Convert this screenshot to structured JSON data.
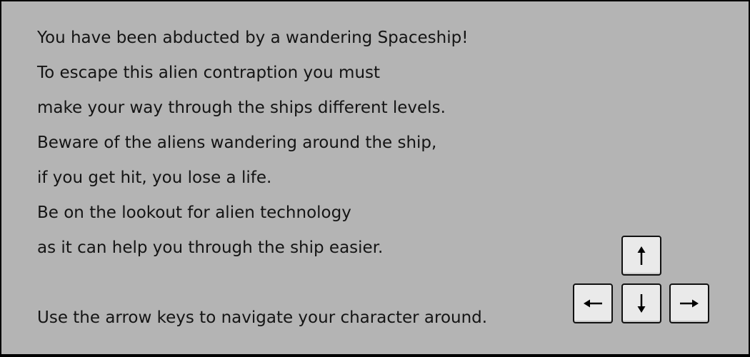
{
  "intro": {
    "lines": [
      "You have been abducted by a wandering Spaceship!",
      "To escape this alien contraption you must",
      "make your way through the ships different levels.",
      "Beware of the aliens wandering around the ship,",
      "if you get hit, you lose a life.",
      "Be on the lookout for alien technology",
      "as it can help you through the ship easier."
    ],
    "controls_hint": "Use the arrow keys to navigate your character around."
  },
  "controls": {
    "keys": [
      {
        "name": "up",
        "icon": "arrow-up-icon"
      },
      {
        "name": "left",
        "icon": "arrow-left-icon"
      },
      {
        "name": "down",
        "icon": "arrow-down-icon"
      },
      {
        "name": "right",
        "icon": "arrow-right-icon"
      }
    ]
  },
  "colors": {
    "panel_background": "#b4b4b4",
    "border": "#000000",
    "text": "#141414",
    "key_face": "#eaeaea"
  }
}
